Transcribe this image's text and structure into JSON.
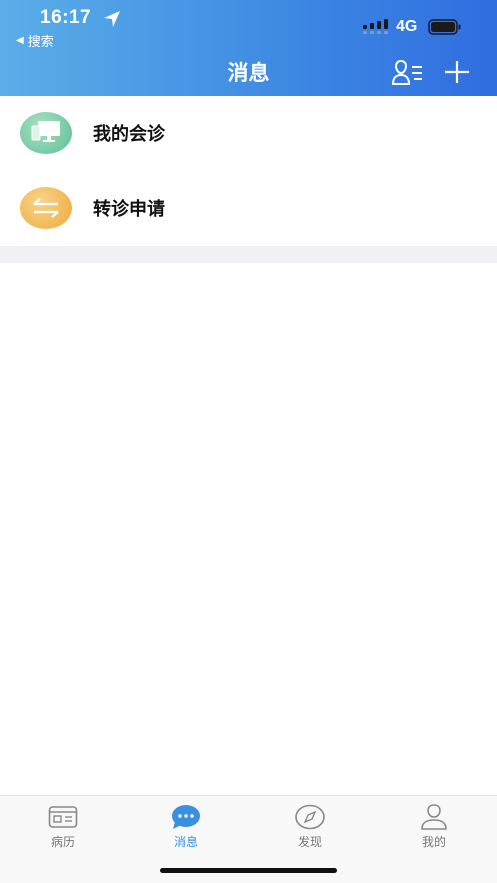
{
  "status_bar": {
    "time": "16:17",
    "back_label": "搜索",
    "network": "4G"
  },
  "header": {
    "title": "消息"
  },
  "list": {
    "items": [
      {
        "label": "我的会诊",
        "icon": "monitor-icon",
        "color": "#62c497"
      },
      {
        "label": "转诊申请",
        "icon": "transfer-arrows-icon",
        "color": "#f0b048"
      }
    ]
  },
  "tabbar": {
    "active_color": "#3a8fe0",
    "tabs": [
      {
        "label": "病历",
        "icon": "medical-record-icon"
      },
      {
        "label": "消息",
        "icon": "chat-bubble-icon"
      },
      {
        "label": "发现",
        "icon": "compass-icon"
      },
      {
        "label": "我的",
        "icon": "user-profile-icon"
      }
    ]
  }
}
